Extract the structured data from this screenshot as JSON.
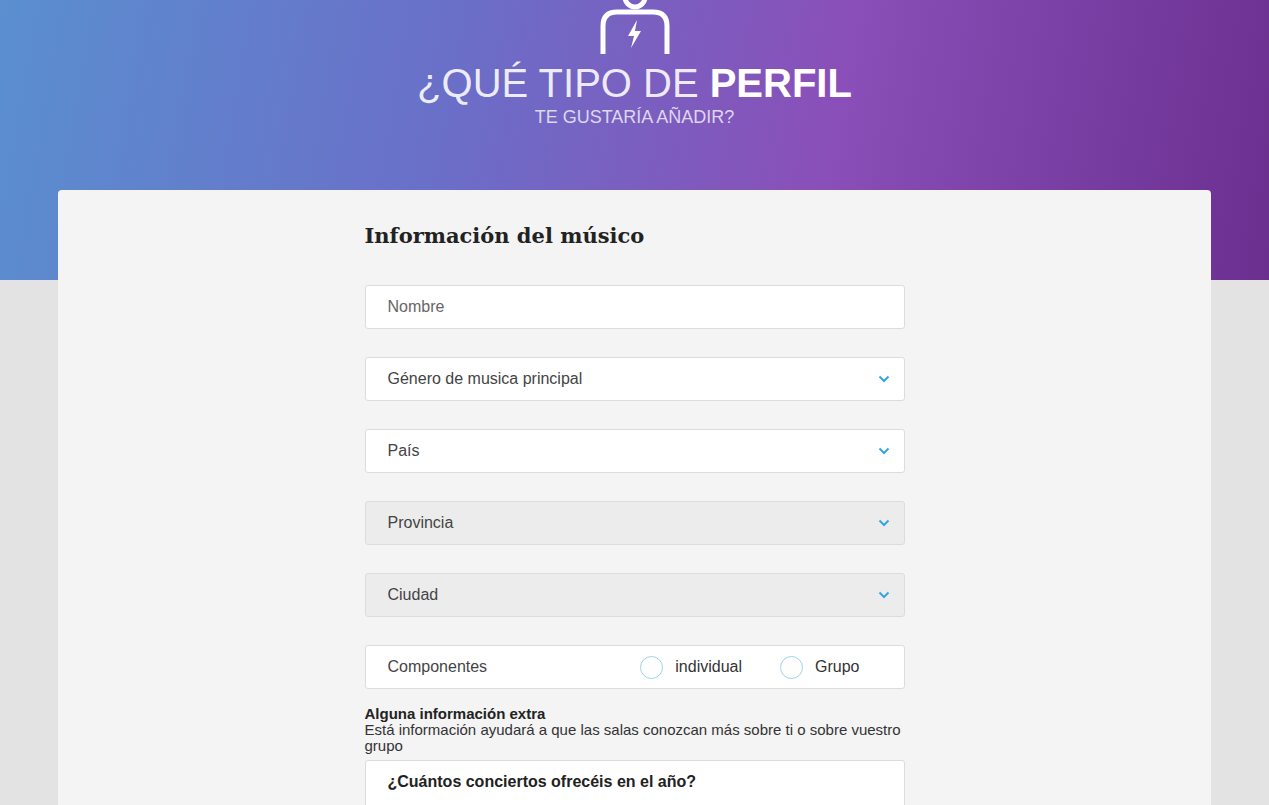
{
  "header": {
    "title_light": "¿QUÉ TIPO DE",
    "title_bold": "PERFIL",
    "subtitle": "TE GUSTARÍA AÑADIR?"
  },
  "form": {
    "heading": "Información del músico",
    "name_field": {
      "placeholder": "Nombre"
    },
    "selects": [
      {
        "label": "Género de musica principal",
        "disabled": false
      },
      {
        "label": "País",
        "disabled": false
      },
      {
        "label": "Provincia",
        "disabled": true
      },
      {
        "label": "Ciudad",
        "disabled": true
      }
    ],
    "components": {
      "label": "Componentes",
      "options": [
        {
          "label": "individual",
          "selected": false
        },
        {
          "label": "Grupo",
          "selected": false
        }
      ]
    },
    "extra": {
      "title": "Alguna información extra",
      "description": "Está información ayudará a que las salas conozcan más sobre ti o sobre vuestro grupo"
    },
    "questions": [
      {
        "label": "¿Cuántos conciertos ofrecéis en el año?"
      }
    ]
  }
}
